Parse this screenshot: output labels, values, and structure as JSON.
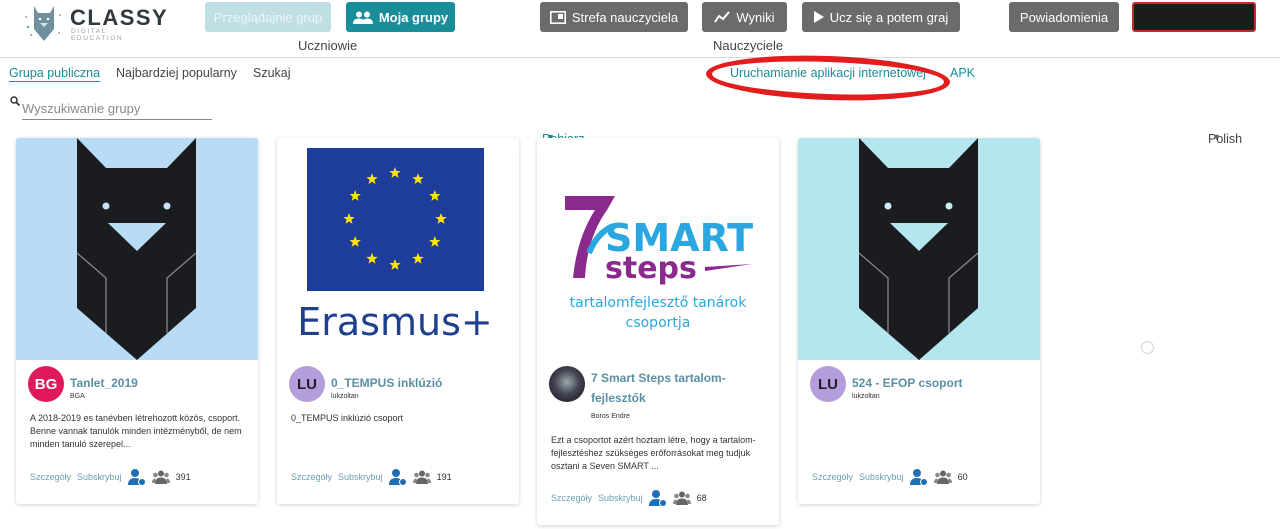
{
  "header": {
    "logo": {
      "name": "CLASSY",
      "tagline": "DIGITAL EDUCATION"
    },
    "students_group": {
      "label": "Uczniowie",
      "buttons": [
        {
          "label": "Przeglądajnie grup",
          "state": "disabled"
        },
        {
          "label": "Moja grupy",
          "icon": "people-icon"
        }
      ]
    },
    "teachers_group": {
      "label": "Nauczyciele",
      "buttons": [
        {
          "label": "Strefa nauczyciela",
          "icon": "panel-icon"
        },
        {
          "label": "Wyniki",
          "icon": "chart-line-icon"
        },
        {
          "label": "Ucz się a potem graj",
          "icon": "play-icon"
        }
      ]
    },
    "notifications_label": "Powiadomienia",
    "account_label": ""
  },
  "subnav": {
    "tabs": [
      {
        "label": "Grupa publiczna",
        "active": true
      },
      {
        "label": "Najbardziej popularny",
        "active": false
      },
      {
        "label": "Szukaj",
        "active": false
      }
    ],
    "mobile_app": "Pobierz aplikację mobilną",
    "web_app": "Uruchamianie aplikacji internetowej",
    "apk": "APK",
    "language": "Polish"
  },
  "search": {
    "placeholder": "Wyszukiwanie grupy",
    "value": ""
  },
  "colors": {
    "accent": "#1a8e98",
    "link": "#6b9fb3",
    "highlight": "#e11d1d"
  },
  "groups": [
    {
      "title": "Tanlet_2019",
      "owner": "BGA",
      "avatar": "BG",
      "avatar_color": "#e0195f",
      "description": "A 2018-2019 es tanévben létrehozott közös, csoport. Benne vannak tanulók minden intézményből, de nem minden tanuló szerepel...",
      "details": "Szczegóły",
      "subscribe": "Subskrybuj",
      "members": "391"
    },
    {
      "title": "0_TEMPUS inklúzió",
      "owner": "lukzoltan",
      "avatar": "LU",
      "avatar_color": "#b39ddb",
      "description": "0_TEMPUS inklúzió csoport",
      "details": "Szczegóły",
      "subscribe": "Subskrybuj",
      "members": "191",
      "image_text": "Erasmus+"
    },
    {
      "title": "7 Smart Steps tartalom-fejlesztők",
      "owner": "Boros Endre",
      "avatar": "",
      "description": "Ezt a csoportot azért hoztam létre, hogy a tartalom-fejlesztéshez szükséges erőforrásokat meg tudjuk osztani a Seven SMART ...",
      "details": "Szczegóły",
      "subscribe": "Subskrybuj",
      "members": "68",
      "image_text": {
        "brand1": "SMART",
        "brand2": "steps",
        "line1": "tartalomfejlesztő tanárok",
        "line2": "csoportja"
      }
    },
    {
      "title": "524 - EFOP csoport",
      "owner": "lukzoltan",
      "avatar": "LU",
      "avatar_color": "#b39ddb",
      "description": "",
      "details": "Szczegóły",
      "subscribe": "Subskrybuj",
      "members": "60"
    }
  ]
}
